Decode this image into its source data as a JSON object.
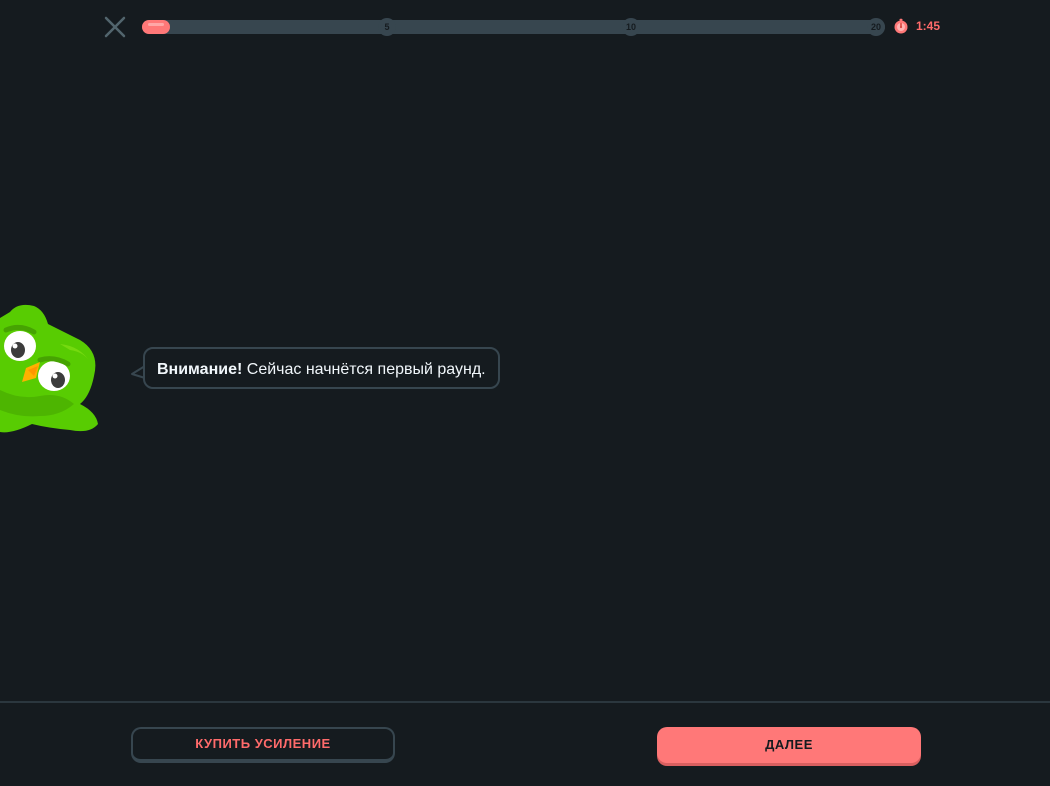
{
  "header": {
    "close_icon": "close-x-icon",
    "progress": {
      "value": 0,
      "milestones": [
        "5",
        "10",
        "20"
      ]
    },
    "timer": {
      "icon": "stopwatch-icon",
      "value": "1:45"
    }
  },
  "main": {
    "character_icon": "owl-mascot",
    "bubble": {
      "emphasis": "Внимание!",
      "text": " Сейчас начнётся первый раунд."
    }
  },
  "footer": {
    "boost_button": "КУПИТЬ УСИЛЕНИЕ",
    "next_button": "ДАЛЕЕ"
  },
  "colors": {
    "background": "#151b1f",
    "accent": "#ff7878",
    "owl_green": "#58cc02",
    "track": "#37464f"
  }
}
